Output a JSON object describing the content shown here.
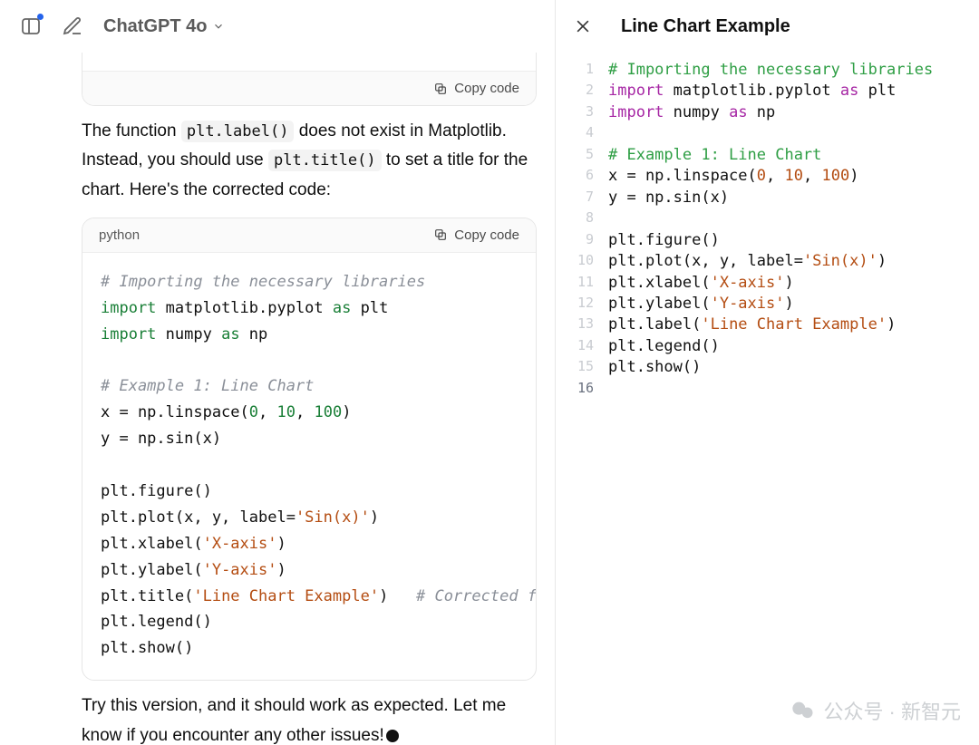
{
  "header": {
    "model_title": "ChatGPT 4o"
  },
  "chat": {
    "top_code_copy_label": "Copy code",
    "explain": {
      "pre1": "The function ",
      "code1": "plt.label()",
      "mid1": " does not exist in Matplotlib. Instead, you should use ",
      "code2": "plt.title()",
      "mid2": " to set a title for the chart. Here's the corrected code:"
    },
    "code_block": {
      "lang": "python",
      "copy_label": "Copy code",
      "lines": {
        "c1": "# Importing the necessary libraries",
        "l2_a": "import",
        "l2_b": " matplotlib.pyplot ",
        "l2_c": "as",
        "l2_d": " plt",
        "l3_a": "import",
        "l3_b": " numpy ",
        "l3_c": "as",
        "l3_d": " np",
        "c2": "# Example 1: Line Chart",
        "l6_a": "x = np.linspace(",
        "l6_n1": "0",
        "l6_s1": ", ",
        "l6_n2": "10",
        "l6_s2": ", ",
        "l6_n3": "100",
        "l6_e": ")",
        "l7": "y = np.sin(x)",
        "l9": "plt.figure()",
        "l10_a": "plt.plot(x, y, label=",
        "l10_s": "'Sin(x)'",
        "l10_e": ")",
        "l11_a": "plt.xlabel(",
        "l11_s": "'X-axis'",
        "l11_e": ")",
        "l12_a": "plt.ylabel(",
        "l12_s": "'Y-axis'",
        "l12_e": ")",
        "l13_a": "plt.title(",
        "l13_s": "'Line Chart Example'",
        "l13_e": ")   ",
        "l13_c": "# Corrected f",
        "l14": "plt.legend()",
        "l15": "plt.show()"
      }
    },
    "outro": "Try this version, and it should work as expected. Let me know if you encounter any other issues!"
  },
  "canvas": {
    "title": "Line Chart Example",
    "gutter": [
      "1",
      "2",
      "3",
      "4",
      "5",
      "6",
      "7",
      "8",
      "9",
      "10",
      "11",
      "12",
      "13",
      "14",
      "15",
      "16"
    ],
    "lines": {
      "l1": "# Importing the necessary libraries",
      "l2_a": "import",
      "l2_b": " matplotlib.pyplot ",
      "l2_c": "as",
      "l2_d": " plt",
      "l3_a": "import",
      "l3_b": " numpy ",
      "l3_c": "as",
      "l3_d": " np",
      "l5": "# Example 1: Line Chart",
      "l6_a": "x = np.linspace(",
      "l6_n1": "0",
      "l6_s1": ", ",
      "l6_n2": "10",
      "l6_s2": ", ",
      "l6_n3": "100",
      "l6_e": ")",
      "l7": "y = np.sin(x)",
      "l9": "plt.figure()",
      "l10_a": "plt.plot(x, y, label=",
      "l10_s": "'Sin(x)'",
      "l10_e": ")",
      "l11_a": "plt.xlabel(",
      "l11_s": "'X-axis'",
      "l11_e": ")",
      "l12_a": "plt.ylabel(",
      "l12_s": "'Y-axis'",
      "l12_e": ")",
      "l13_a": "plt.label(",
      "l13_s": "'Line Chart Example'",
      "l13_e": ")",
      "l14": "plt.legend()",
      "l15": "plt.show()"
    }
  },
  "watermark": {
    "text": "公众号 · 新智元"
  }
}
